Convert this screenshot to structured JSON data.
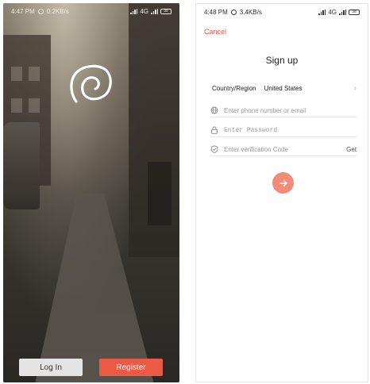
{
  "welcome_screen": {
    "statusbar": {
      "time": "4:47 PM",
      "speed": "0.2KB/s",
      "network": "4G",
      "battery": "38"
    },
    "logo": "swirl-logo-icon",
    "login_label": "Log In",
    "register_label": "Register"
  },
  "signup_screen": {
    "statusbar": {
      "time": "4:48 PM",
      "speed": "3.4KB/s",
      "network": "4G",
      "battery": "38"
    },
    "cancel_label": "Cancel",
    "title": "Sign up",
    "region": {
      "label": "Country/Region",
      "value": "United States",
      "icon": "chevron-right-icon"
    },
    "phone_field": {
      "placeholder": "Enter phone number or email",
      "value": "",
      "icon": "globe-icon"
    },
    "password_field": {
      "placeholder": "Enter Password",
      "value": "",
      "icon": "lock-icon"
    },
    "code_field": {
      "placeholder": "Enter verification Code",
      "value": "",
      "icon": "shield-check-icon",
      "get_label": "Get"
    },
    "submit_icon": "arrow-right-icon",
    "colors": {
      "accent": "#ea5a45",
      "submit": "#f08c78"
    }
  }
}
